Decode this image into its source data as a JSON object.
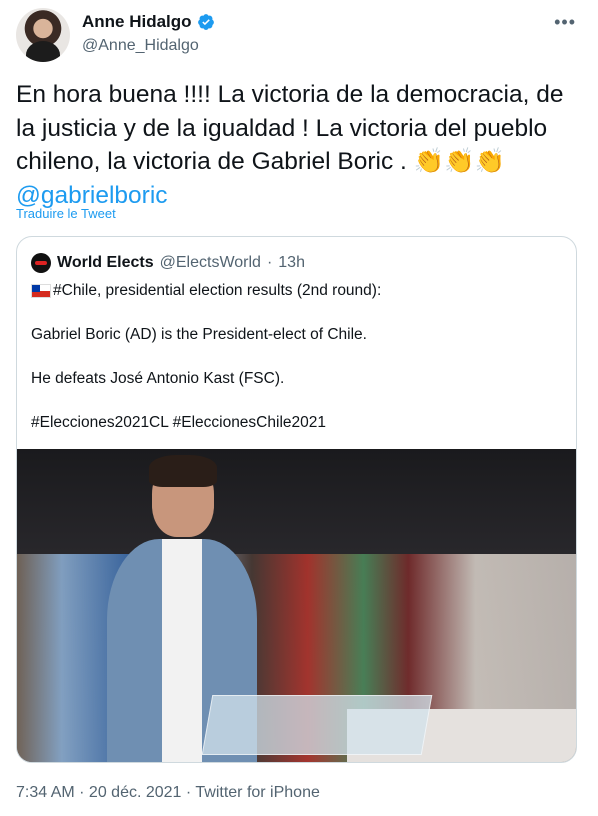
{
  "author": {
    "display_name": "Anne Hidalgo",
    "handle": "@Anne_Hidalgo",
    "verified_color": "#1d9bf0"
  },
  "tweet": {
    "text": "En hora buena !!!! La victoria de la democracia, de la justicia y de la igualdad ! La victoria del pueblo chileno, la victoria de Gabriel Boric . 👏👏👏",
    "mention": "@gabrielboric",
    "translate_label": "Traduire le Tweet"
  },
  "quoted": {
    "name": "World Elects",
    "handle": "@ElectsWorld",
    "separator": "·",
    "time": "13h",
    "lines": [
      "#Chile, presidential election results (2nd round):",
      "Gabriel Boric (AD) is the President-elect of Chile.",
      "He defeats José Antonio Kast (FSC).",
      "#Elecciones2021CL #EleccionesChile2021"
    ]
  },
  "footer": {
    "meta": "7:34 AM · 20 déc. 2021 · Twitter for iPhone"
  },
  "colors": {
    "link": "#1d9bf0",
    "secondary_text": "#536471",
    "border": "#cfd9de"
  }
}
